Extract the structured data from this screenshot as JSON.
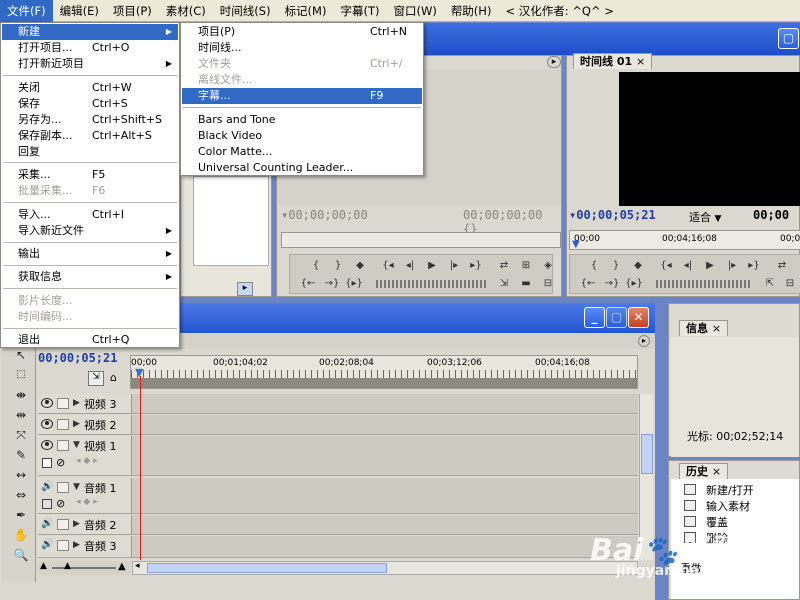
{
  "menubar": {
    "items": [
      {
        "label": "文件(F)"
      },
      {
        "label": "编辑(E)"
      },
      {
        "label": "项目(P)"
      },
      {
        "label": "素材(C)"
      },
      {
        "label": "时间线(S)"
      },
      {
        "label": "标记(M)"
      },
      {
        "label": "字幕(T)"
      },
      {
        "label": "窗口(W)"
      },
      {
        "label": "帮助(H)"
      },
      {
        "label": "< 汉化作者: ^Q^ >"
      }
    ]
  },
  "file_menu": {
    "new": "新建",
    "open_project": "打开项目...",
    "open_project_sc": "Ctrl+O",
    "open_recent_project": "打开新近项目",
    "close": "关闭",
    "close_sc": "Ctrl+W",
    "save": "保存",
    "save_sc": "Ctrl+S",
    "save_as": "另存为...",
    "save_as_sc": "Ctrl+Shift+S",
    "save_copy": "保存副本...",
    "save_copy_sc": "Ctrl+Alt+S",
    "revert": "回复",
    "capture": "采集...",
    "capture_sc": "F5",
    "batch_capture": "批量采集...",
    "batch_capture_sc": "F6",
    "import": "导入...",
    "import_sc": "Ctrl+I",
    "import_recent": "导入新近文件",
    "export": "输出",
    "get_info": "获取信息",
    "clip_duration": "影片长度...",
    "timecode": "时间编码...",
    "exit": "退出",
    "exit_sc": "Ctrl+Q"
  },
  "new_submenu": {
    "project": "项目(P)",
    "project_sc": "Ctrl+N",
    "timeline": "时间线...",
    "folder": "文件夹",
    "folder_sc": "Ctrl+/",
    "offline_file": "离线文件...",
    "title": "字幕...",
    "title_sc": "F9",
    "bars_tone": "Bars and Tone",
    "black_video": "Black Video",
    "color_matte": "Color Matte...",
    "counting_leader": "Universal Counting Leader..."
  },
  "monitor": {
    "program_tab": "时间线 01",
    "source_tc_left": "00;00;00;00",
    "source_tc_right": "00;00;00;00",
    "program_tc_left": "00;00;05;21",
    "fit_label": "适合",
    "program_tc_right": "00;00",
    "ruler_start": "00;00",
    "ruler_mid": "00;04;16;08",
    "ruler_end": "00;0"
  },
  "timeline": {
    "current_tc": "00;00;05;21",
    "ruler": [
      "00;00",
      "00;01;04;02",
      "00;02;08;04",
      "00;03;12;06",
      "00;04;16;08"
    ],
    "tracks": {
      "v3": "视频 3",
      "v2": "视频 2",
      "v1": "视频 1",
      "a1": "音频 1",
      "a2": "音频 2",
      "a3": "音频 3"
    }
  },
  "info_panel": {
    "tab": "信息",
    "cursor": "光标: 00;02;52;14"
  },
  "history_panel": {
    "tab": "历史",
    "items": [
      "新建/打开",
      "输入素材",
      "覆盖",
      "删除",
      "重做"
    ]
  }
}
